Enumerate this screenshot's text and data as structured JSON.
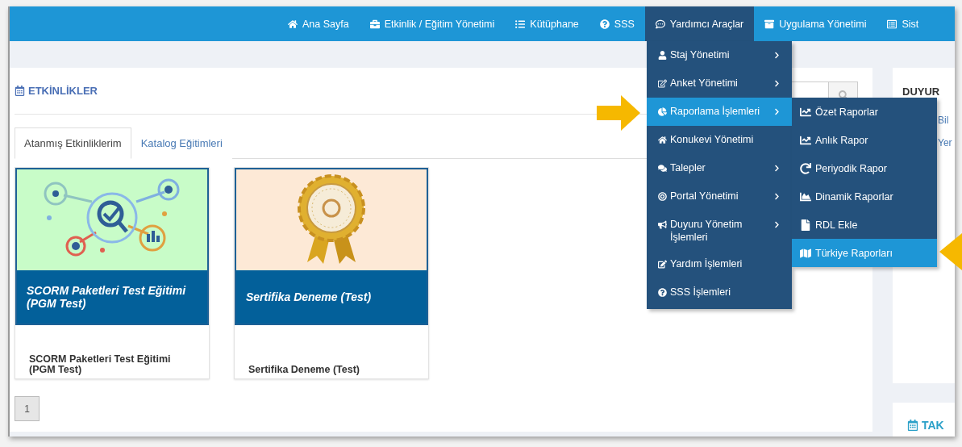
{
  "nav": {
    "items": [
      {
        "label": "Ana Sayfa",
        "selected": false
      },
      {
        "label": "Etkinlik / Eğitim Yönetimi",
        "selected": false
      },
      {
        "label": "Kütüphane",
        "selected": false
      },
      {
        "label": "SSS",
        "selected": false
      },
      {
        "label": "Yardımcı Araçlar",
        "selected": true
      },
      {
        "label": "Uygulama Yönetimi",
        "selected": false
      },
      {
        "label": "Sist",
        "selected": false
      }
    ]
  },
  "menu": {
    "items": [
      {
        "label": "Staj Yönetimi",
        "has_submenu": true,
        "selected": false
      },
      {
        "label": "Anket Yönetimi",
        "has_submenu": true,
        "selected": false
      },
      {
        "label": "Raporlama İşlemleri",
        "has_submenu": true,
        "selected": true
      },
      {
        "label": "Konukevi Yönetimi",
        "has_submenu": false,
        "selected": false
      },
      {
        "label": "Talepler",
        "has_submenu": true,
        "selected": false
      },
      {
        "label": "Portal Yönetimi",
        "has_submenu": true,
        "selected": false
      },
      {
        "label": "Duyuru Yönetim İşlemleri",
        "has_submenu": true,
        "selected": false
      },
      {
        "label": "Yardım İşlemleri",
        "has_submenu": false,
        "selected": false
      },
      {
        "label": "SSS İşlemleri",
        "has_submenu": false,
        "selected": false
      }
    ],
    "submenu": {
      "items": [
        {
          "label": "Özet Raporlar",
          "selected": false
        },
        {
          "label": "Anlık Rapor",
          "selected": false
        },
        {
          "label": "Periyodik Rapor",
          "selected": false
        },
        {
          "label": "Dinamik Raporlar",
          "selected": false
        },
        {
          "label": "RDL Ekle",
          "selected": false
        },
        {
          "label": "Türkiye Raporları",
          "selected": true
        }
      ]
    }
  },
  "page": {
    "title": "ETKİNLİKLER",
    "tabs": [
      {
        "label": "Atanmış Etkinliklerim",
        "selected": true
      },
      {
        "label": "Katalog Eğitimleri",
        "selected": false
      }
    ],
    "cards": [
      {
        "banner_title": "SCORM Paketleri Test Eğitimi (PGM Test)",
        "title": "SCORM Paketleri Test Eğitimi (PGM Test)"
      },
      {
        "banner_title": "Sertifika Deneme (Test)",
        "title": "Sertifika Deneme (Test)"
      }
    ],
    "pagination": [
      "1"
    ]
  },
  "side_panel": {
    "title": "DUYUR",
    "items": [
      "Bil",
      "Yer"
    ],
    "calendar_title": "TAK"
  }
}
